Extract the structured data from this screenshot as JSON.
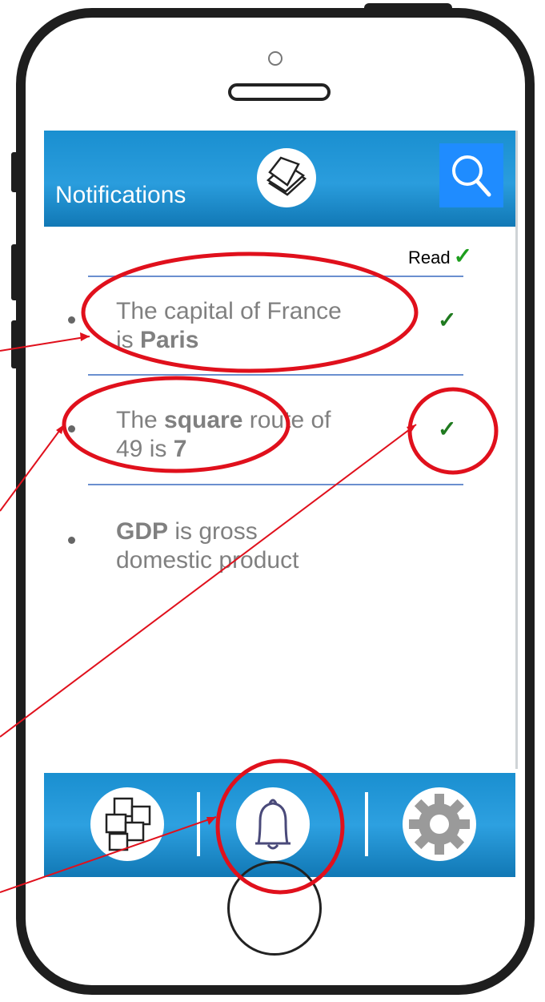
{
  "header": {
    "title": "Notifications",
    "center_icon": "stack-of-notes-icon",
    "search_icon": "search-icon"
  },
  "read_column": {
    "label": "Read",
    "icon": "checkmark-icon"
  },
  "notifications": [
    {
      "parts": [
        {
          "text": "The capital of France ",
          "bold": false
        },
        {
          "text": "is ",
          "bold": false
        },
        {
          "text": "Paris",
          "bold": true
        }
      ],
      "line1": "The capital of France",
      "line2_pre": "is ",
      "line2_bold": "Paris",
      "read": true
    },
    {
      "line1_pre": "The ",
      "line1_bold": "square",
      "line1_post": " route of",
      "line2_pre": "49 is ",
      "line2_bold": "7",
      "read": true
    },
    {
      "line1_bold": "GDP",
      "line1_post": " is gross",
      "line2": "domestic product",
      "read": false
    }
  ],
  "tabbar": {
    "tabs": [
      {
        "icon": "notes-collection-icon"
      },
      {
        "icon": "bell-icon"
      },
      {
        "icon": "gear-icon"
      }
    ]
  },
  "colors": {
    "header_blue": "#1a8fd0",
    "search_blue": "#1f8cff",
    "annotation_red": "#e0101c",
    "check_green": "#1f7a1f",
    "text_gray": "#808080"
  }
}
